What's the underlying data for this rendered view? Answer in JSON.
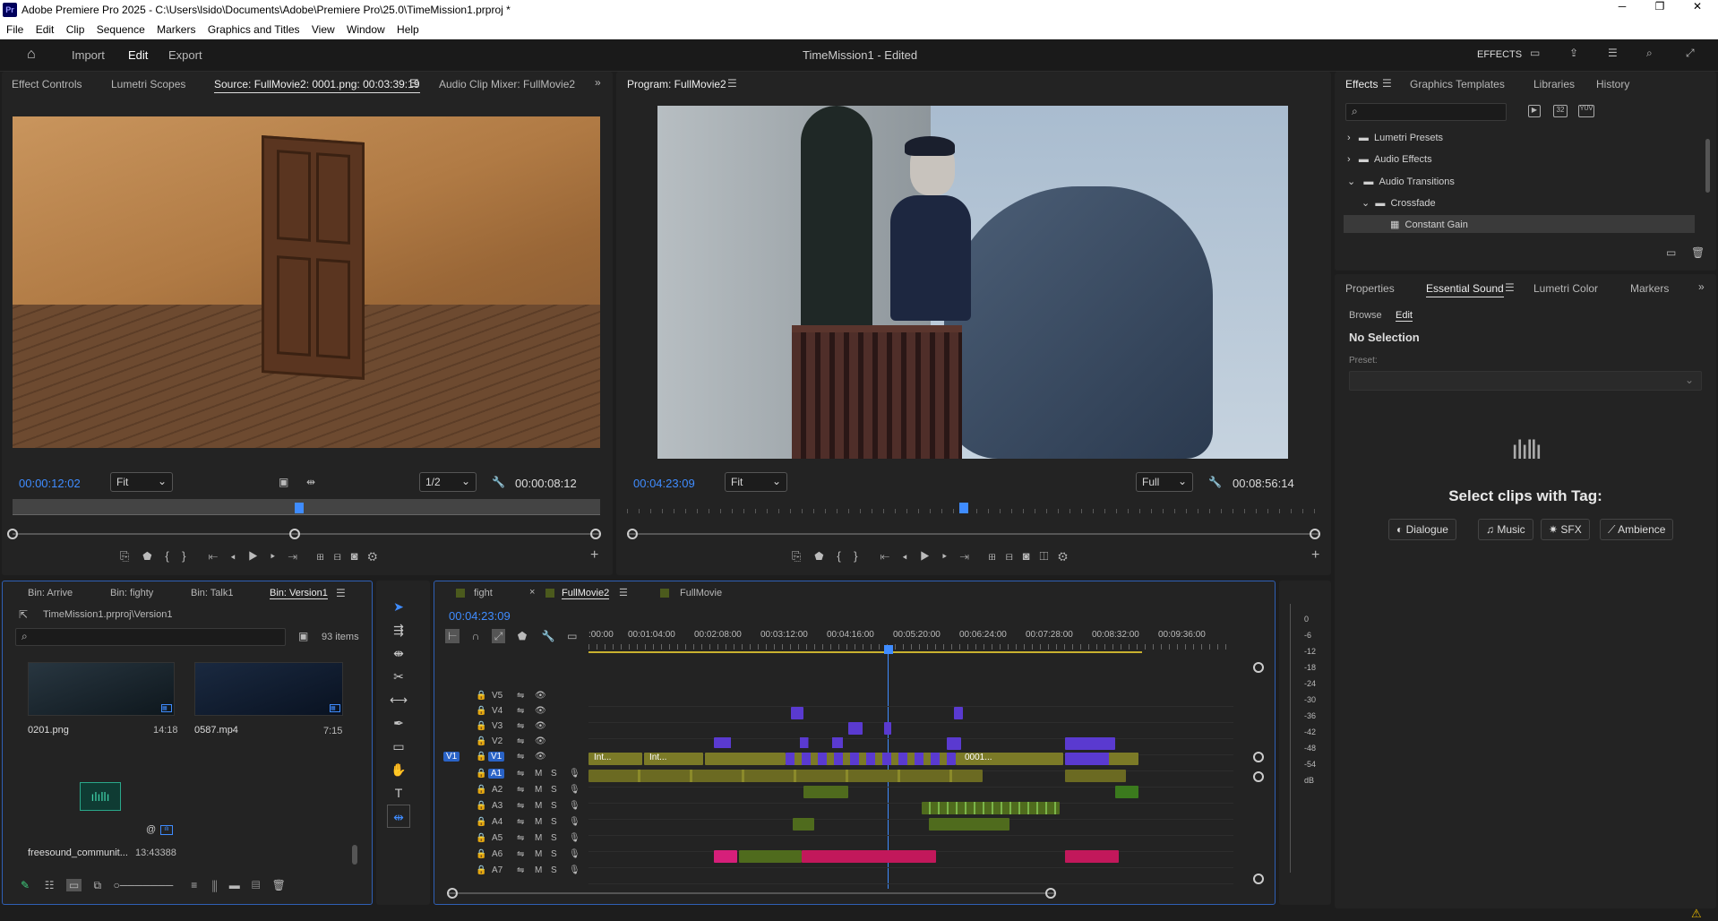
{
  "window": {
    "app_icon": "Pr",
    "title": "Adobe Premiere Pro 2025 - C:\\Users\\lsido\\Documents\\Adobe\\Premiere Pro\\25.0\\TimeMission1.prproj *"
  },
  "menu": [
    "File",
    "Edit",
    "Clip",
    "Sequence",
    "Markers",
    "Graphics and Titles",
    "View",
    "Window",
    "Help"
  ],
  "workspace": {
    "import": "Import",
    "edit": "Edit",
    "export": "Export",
    "project_title": "TimeMission1",
    "edited": "- Edited",
    "effects_label": "EFFECTS"
  },
  "source_panel": {
    "tabs": [
      "Effect Controls",
      "Lumetri Scopes",
      "Source: FullMovie2: 0001.png: 00:03:39:19",
      "Audio Clip Mixer: FullMovie2"
    ],
    "timecode": "00:00:12:02",
    "fit": "Fit",
    "resolution": "1/2",
    "duration": "00:00:08:12"
  },
  "program_panel": {
    "tab": "Program: FullMovie2",
    "timecode": "00:04:23:09",
    "fit": "Fit",
    "quality": "Full",
    "duration": "00:08:56:14"
  },
  "effects_panel": {
    "tabs": [
      "Effects",
      "Graphics Templates",
      "Libraries",
      "History"
    ],
    "tree": [
      {
        "label": "Lumetri Presets",
        "expanded": false
      },
      {
        "label": "Audio Effects",
        "expanded": false
      },
      {
        "label": "Audio Transitions",
        "expanded": true
      },
      {
        "label": "Crossfade",
        "expanded": true
      },
      {
        "label": "Constant Gain",
        "selected": true
      }
    ],
    "filter_buttons": [
      "32",
      "YUV"
    ]
  },
  "essential_panel": {
    "tabs": [
      "Properties",
      "Essential Sound",
      "Lumetri Color",
      "Markers"
    ],
    "subtabs": [
      "Browse",
      "Edit"
    ],
    "no_selection": "No Selection",
    "preset_label": "Preset:",
    "select_title": "Select clips with Tag:",
    "tags": [
      "Dialogue",
      "Music",
      "SFX",
      "Ambience"
    ]
  },
  "project_panel": {
    "tabs": [
      "Bin: Arrive",
      "Bin: fighty",
      "Bin: Talk1",
      "Bin: Version1"
    ],
    "path": "TimeMission1.prproj\\Version1",
    "items_count": "93 items",
    "items": [
      {
        "name": "0201.png",
        "duration": "14:18"
      },
      {
        "name": "0587.mp4",
        "duration": "7:15"
      },
      {
        "name": "freesound_communit...",
        "duration": "13:43388"
      }
    ]
  },
  "timeline": {
    "tabs": [
      "fight",
      "FullMovie2",
      "FullMovie"
    ],
    "timecode": "00:04:23:09",
    "ruler": [
      ":00:00",
      "00:01:04:00",
      "00:02:08:00",
      "00:03:12:00",
      "00:04:16:00",
      "00:05:20:00",
      "00:06:24:00",
      "00:07:28:00",
      "00:08:32:00",
      "00:09:36:00"
    ],
    "video_tracks": [
      "V5",
      "V4",
      "V3",
      "V2",
      "V1"
    ],
    "audio_tracks": [
      "A1",
      "A2",
      "A3",
      "A4",
      "A5",
      "A6",
      "A7"
    ],
    "clip_labels": [
      "Int...",
      "Int...",
      "0001..."
    ],
    "track_buttons": {
      "mute": "M",
      "solo": "S"
    },
    "source_patch_v": "V1",
    "source_patch_a": "A1"
  },
  "meter": {
    "scale": [
      "0",
      "-6",
      "-12",
      "-18",
      "-24",
      "-30",
      "-36",
      "-42",
      "-48",
      "-54",
      "dB"
    ]
  },
  "colors": {
    "accent": "#3f8cff",
    "video_clip": "#7b7a27",
    "audio_clip": "#4f6b1d",
    "purple_clip": "#5a3ad0",
    "pink_clip": "#c2185b"
  }
}
